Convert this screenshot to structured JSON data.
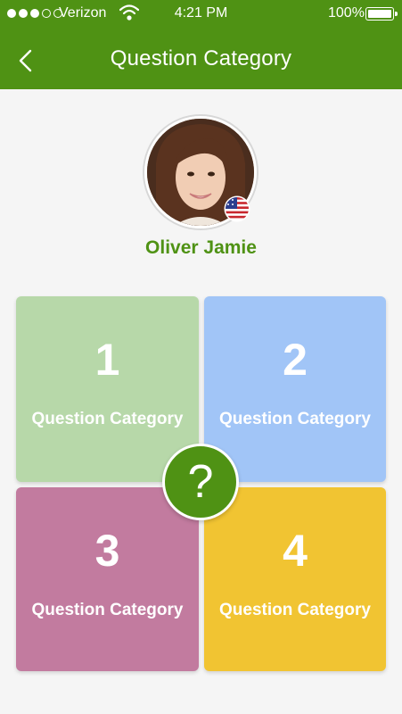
{
  "status_bar": {
    "carrier": "Verizon",
    "time": "4:21 PM",
    "battery": "100%"
  },
  "header": {
    "title": "Question Category"
  },
  "profile": {
    "name": "Oliver Jamie"
  },
  "categories": [
    {
      "number": "1",
      "label": "Question Category",
      "color": "#b7d8a9"
    },
    {
      "number": "2",
      "label": "Question Category",
      "color": "#a1c5f7"
    },
    {
      "number": "3",
      "label": "Question Category",
      "color": "#c27b9f"
    },
    {
      "number": "4",
      "label": "Question Category",
      "color": "#f1c432"
    }
  ],
  "help_button": {
    "symbol": "?"
  },
  "colors": {
    "accent": "#4f9214",
    "background": "#f5f5f5"
  }
}
